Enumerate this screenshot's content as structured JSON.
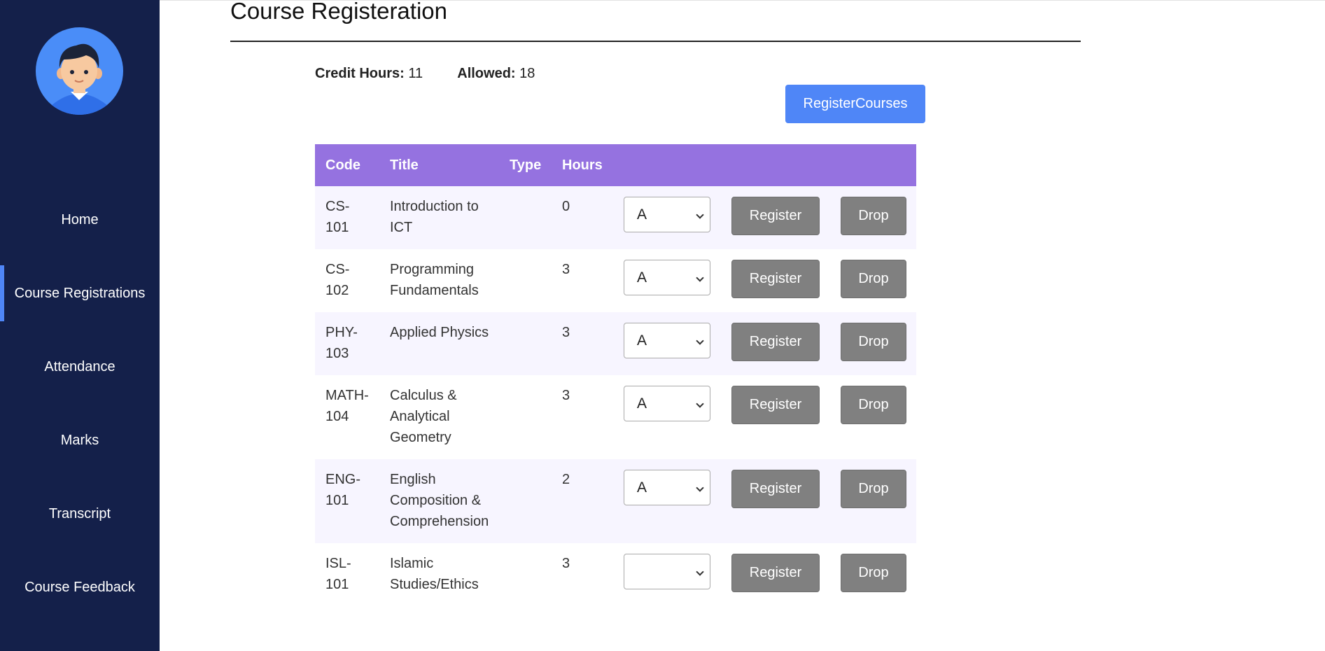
{
  "sidebar": {
    "items": [
      {
        "label": "Home",
        "active": false
      },
      {
        "label": "Course Registrations",
        "active": true
      },
      {
        "label": "Attendance",
        "active": false
      },
      {
        "label": "Marks",
        "active": false
      },
      {
        "label": "Transcript",
        "active": false
      },
      {
        "label": "Course Feedback",
        "active": false
      }
    ]
  },
  "page": {
    "title": "Course Registeration",
    "credit_hours_label": "Credit Hours:",
    "credit_hours_value": "11",
    "allowed_label": "Allowed:",
    "allowed_value": "18",
    "register_all_label": "RegisterCourses"
  },
  "table": {
    "headers": [
      "Code",
      "Title",
      "Type",
      "Hours"
    ],
    "register_label": "Register",
    "drop_label": "Drop",
    "rows": [
      {
        "code": "CS-\n101",
        "title": "Introduction to\nICT",
        "type": "",
        "hours": "0",
        "grade": "A"
      },
      {
        "code": "CS-\n102",
        "title": "Programming\nFundamentals",
        "type": "",
        "hours": "3",
        "grade": "A"
      },
      {
        "code": "PHY-\n103",
        "title": "Applied Physics",
        "type": "",
        "hours": "3",
        "grade": "A"
      },
      {
        "code": "MATH-\n104",
        "title": "Calculus &\nAnalytical\nGeometry",
        "type": "",
        "hours": "3",
        "grade": "A"
      },
      {
        "code": "ENG-\n101",
        "title": "English\nComposition &\nComprehension",
        "type": "",
        "hours": "2",
        "grade": "A"
      },
      {
        "code": "ISL-\n101",
        "title": "Islamic\nStudies/Ethics",
        "type": "",
        "hours": "3",
        "grade": ""
      }
    ]
  },
  "colors": {
    "sidebar_bg": "#14204a",
    "accent": "#4f86f7",
    "table_header": "#9572e0",
    "row_alt": "#f7f5ff",
    "button_gray": "#808080"
  }
}
